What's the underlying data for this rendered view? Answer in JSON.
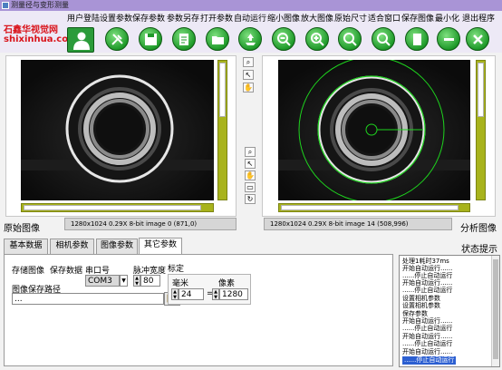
{
  "window": {
    "title": "测量径与变形测量"
  },
  "brand": {
    "name": "石鑫华视觉网",
    "url": "shixinhua.com"
  },
  "menu": [
    "用户登陆",
    "设置参数",
    "保存参数",
    "参数另存",
    "打开参数",
    "自动运行",
    "缩小图像",
    "放大图像",
    "原始尺寸",
    "适合窗口",
    "保存图像",
    "最小化",
    "退出程序"
  ],
  "toolbar_icons": [
    "user-icon",
    "settings-icon",
    "save-icon",
    "save-as-icon",
    "open-folder-icon",
    "auto-run-icon",
    "zoom-out-icon",
    "zoom-in-icon",
    "original-size-icon",
    "fit-window-icon",
    "save-image-icon",
    "minimize-icon",
    "exit-icon"
  ],
  "colors": {
    "accent_green": "#2b9b3a",
    "scroll_olive": "#a8b31c",
    "selection_blue": "#2c5fd1"
  },
  "images": {
    "original_label": "原始图像",
    "analysis_label": "分析图像",
    "original_status": "1280x1024 0.29X 8-bit image 0      (871,0)",
    "analysis_status": "1280x1024 0.29X 8-bit image 14     (508,996)"
  },
  "tabs": [
    "基本数据",
    "相机参数",
    "图像参数",
    "其它参数"
  ],
  "active_tab": "其它参数",
  "form": {
    "save_image_label": "存储图像",
    "save_data_label": "保存数据",
    "save_path_label": "图像保存路径",
    "save_path_value": "...",
    "port_label": "串口号",
    "port_value": "COM3",
    "pulse_width_label": "脉冲宽度",
    "pulse_width_value": "80",
    "calibration_label": "标定",
    "mm_label": "毫米",
    "mm_value": "24",
    "pixel_label": "像素",
    "pixel_value": "1280",
    "equals": "="
  },
  "status_panel": {
    "title": "状态提示",
    "lines": [
      "处理1耗时37ms",
      "开始自动运行......",
      "......停止自动运行",
      "开始自动运行......",
      "......停止自动运行",
      "设置相机参数",
      "设置相机参数",
      "保存参数",
      "开始自动运行......",
      "......停止自动运行",
      "开始自动运行......",
      "......停止自动运行",
      "开始自动运行......",
      "......停止自动运行"
    ]
  }
}
